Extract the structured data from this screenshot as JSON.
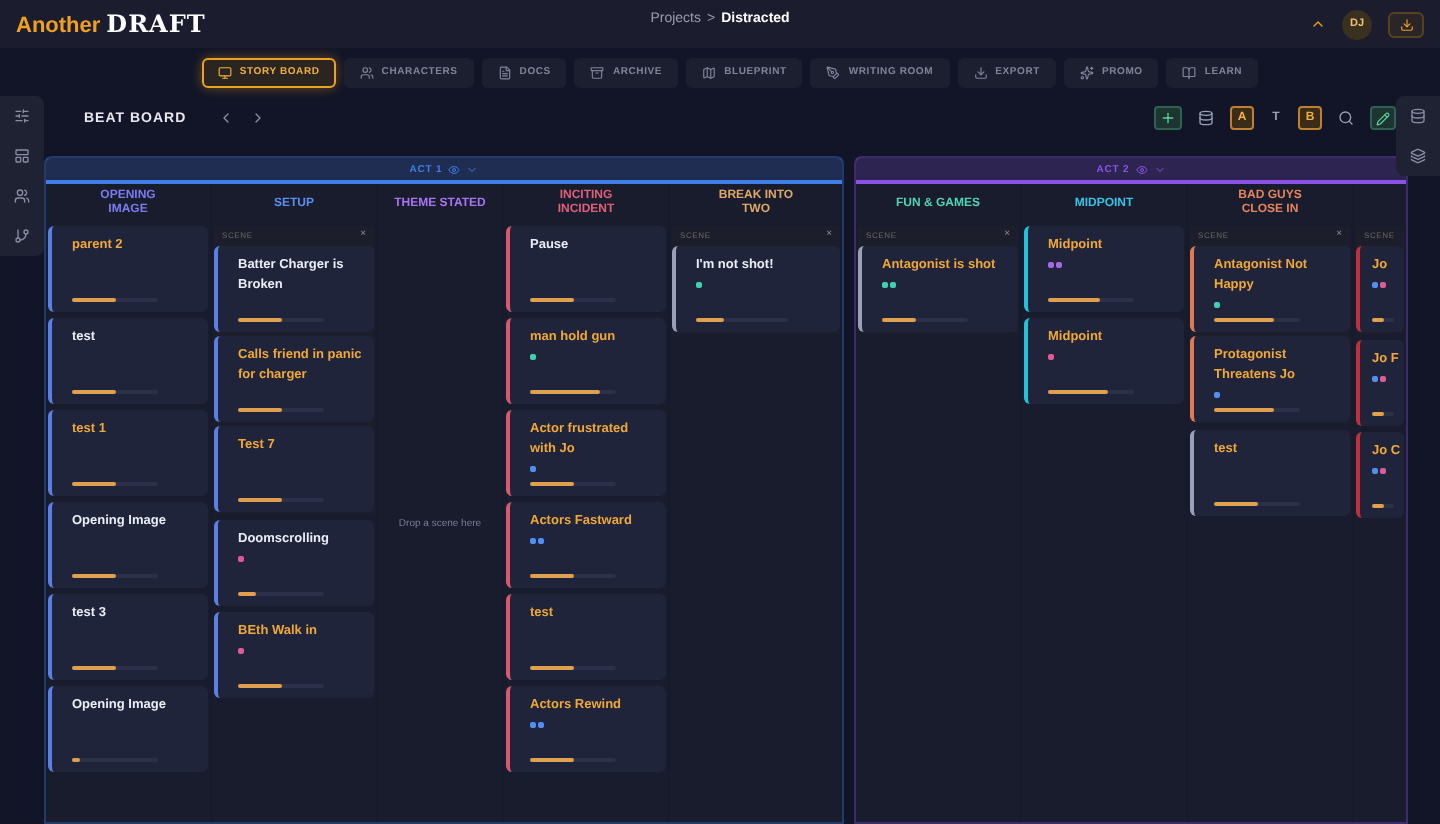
{
  "app": {
    "logo_first": "Another",
    "logo_second": "DRAFT"
  },
  "breadcrumb": {
    "parent": "Projects",
    "separator": ">",
    "current": "Distracted"
  },
  "user": {
    "initials": "DJ"
  },
  "tabs": [
    {
      "label": "STORY BOARD",
      "selected": true
    },
    {
      "label": "CHARACTERS",
      "selected": false
    },
    {
      "label": "DOCS",
      "selected": false
    },
    {
      "label": "ARCHIVE",
      "selected": false
    },
    {
      "label": "BLUEPRINT",
      "selected": false
    },
    {
      "label": "WRITING ROOM",
      "selected": false
    },
    {
      "label": "EXPORT",
      "selected": false
    },
    {
      "label": "PROMO",
      "selected": false
    },
    {
      "label": "LEARN",
      "selected": false
    }
  ],
  "toolbar": {
    "title": "BEAT BOARD",
    "tools": [
      {
        "kind": "add"
      },
      {
        "kind": "table"
      },
      {
        "kind": "letter",
        "label": "A",
        "active": true
      },
      {
        "kind": "letter",
        "label": "T",
        "active": false
      },
      {
        "kind": "letter",
        "label": "B",
        "active": true
      },
      {
        "kind": "search"
      },
      {
        "kind": "edit"
      }
    ]
  },
  "acts": [
    {
      "label": "ACT 1",
      "color": "#3f7fe6",
      "columns": [
        {
          "title": "OPENING IMAGE",
          "color": "#7b7bf2",
          "items": [
            {
              "kind": "card",
              "title": "parent 2",
              "highlighted": true,
              "color": "#5b7fe6",
              "level": 0.5
            },
            {
              "kind": "card",
              "title": "test",
              "highlighted": false,
              "color": "#5b7fe6",
              "level": 0.5
            },
            {
              "kind": "card",
              "title": "test 1",
              "highlighted": true,
              "color": "#5b7fe6",
              "level": 0.5
            },
            {
              "kind": "card",
              "title": "Opening Image",
              "highlighted": false,
              "color": "#5b7fe6",
              "level": 0.5
            },
            {
              "kind": "card",
              "title": "test 3",
              "highlighted": false,
              "color": "#5b7fe6",
              "level": 0.5
            },
            {
              "kind": "card",
              "title": "Opening Image",
              "highlighted": false,
              "color": "#5b7fe6",
              "level": 0.1
            }
          ]
        },
        {
          "title": "SETUP",
          "color": "#5b8ff0",
          "items": [
            {
              "kind": "group",
              "label": "SCENE",
              "close": "×",
              "cards": [
                {
                  "title": "Batter Charger is Broken",
                  "highlighted": false,
                  "color": "#5b7fe6",
                  "level": 0.5
                },
                {
                  "title": "Calls friend in panic for charger",
                  "highlighted": true,
                  "color": "#5b7fe6",
                  "level": 0.5
                },
                {
                  "title": "Test 7",
                  "highlighted": true,
                  "color": "#5b7fe6",
                  "level": 0.5
                }
              ]
            },
            {
              "kind": "card",
              "title": "Doomscrolling",
              "highlighted": false,
              "color": "#5b7fe6",
              "level": 0.2,
              "tags": [
                {
                  "color": "#e05a9a"
                }
              ]
            },
            {
              "kind": "card",
              "title": "BEth Walk in",
              "highlighted": true,
              "color": "#5b7fe6",
              "level": 0.5,
              "tags": [
                {
                  "color": "#e05a9a"
                }
              ]
            }
          ]
        },
        {
          "title": "THEME STATED",
          "color": "#a874f2",
          "hint": "Drop a scene here"
        },
        {
          "title": "INCITING INCIDENT",
          "color": "#e0607a",
          "items": [
            {
              "kind": "card",
              "title": "Pause",
              "highlighted": false,
              "color": "#d85a6e",
              "level": 0.5
            },
            {
              "kind": "card",
              "title": "man hold gun",
              "highlighted": true,
              "color": "#d85a6e",
              "level": 0.8,
              "tags": [
                {
                  "color": "#3fd0b0"
                }
              ]
            },
            {
              "kind": "card",
              "title": "Actor frustrated with Jo",
              "highlighted": true,
              "color": "#d85a6e",
              "level": 0.5,
              "tags": [
                {
                  "color": "#4f8ff0"
                }
              ]
            },
            {
              "kind": "card",
              "title": "Actors Fastward",
              "highlighted": true,
              "color": "#d85a6e",
              "level": 0.5,
              "tags": [
                {
                  "color": "#4f8ff0"
                },
                {
                  "color": "#4f8ff0"
                }
              ]
            },
            {
              "kind": "card",
              "title": "test",
              "highlighted": true,
              "color": "#d85a6e",
              "level": 0.5
            },
            {
              "kind": "card",
              "title": "Actors Rewind",
              "highlighted": true,
              "color": "#d85a6e",
              "level": 0.5,
              "tags": [
                {
                  "color": "#4f8ff0"
                },
                {
                  "color": "#4f8ff0"
                }
              ]
            }
          ]
        },
        {
          "title": "BREAK INTO TWO",
          "color": "#e0a868",
          "items": [
            {
              "kind": "group",
              "label": "SCENE",
              "close": "×",
              "cards": [
                {
                  "title": "I'm not shot!",
                  "highlighted": false,
                  "color": "#9aa0b8",
                  "level": 0.3,
                  "tags": [
                    {
                      "color": "#3fd0b0"
                    }
                  ]
                }
              ]
            }
          ]
        }
      ]
    },
    {
      "label": "ACT 2",
      "color": "#8c52e6",
      "columns": [
        {
          "title": "FUN & GAMES",
          "color": "#4fd4b4",
          "items": [
            {
              "kind": "group",
              "label": "SCENE",
              "close": "×",
              "cards": [
                {
                  "title": "Antagonist is shot",
                  "highlighted": true,
                  "color": "#9aa0b8",
                  "level": 0.4,
                  "tags": [
                    {
                      "color": "#3fd0b0"
                    },
                    {
                      "color": "#3fd0b0"
                    }
                  ]
                }
              ]
            }
          ]
        },
        {
          "title": "MIDPOINT",
          "color": "#38c4e6",
          "items": [
            {
              "kind": "card",
              "title": "Midpoint",
              "highlighted": true,
              "color": "#22c2dc",
              "level": 0.6,
              "tags": [
                {
                  "color": "#a06ae0"
                },
                {
                  "color": "#a06ae0"
                }
              ]
            },
            {
              "kind": "card",
              "title": "Midpoint",
              "highlighted": true,
              "color": "#22c2dc",
              "level": 0.7,
              "tags": [
                {
                  "color": "#e05a9a"
                }
              ]
            }
          ]
        },
        {
          "title": "BAD GUYS CLOSE IN",
          "color": "#e8845c",
          "items": [
            {
              "kind": "group",
              "label": "SCENE",
              "close": "×",
              "cards": [
                {
                  "title": "Antagonist Not Happy",
                  "highlighted": true,
                  "color": "#e07a52",
                  "level": 0.7,
                  "tags": [
                    {
                      "color": "#3fd0b0"
                    }
                  ]
                },
                {
                  "title": "Protagonist Threatens Jo",
                  "highlighted": true,
                  "color": "#e07a52",
                  "level": 0.7,
                  "tags": [
                    {
                      "color": "#4f8ff0"
                    }
                  ]
                }
              ]
            },
            {
              "kind": "card",
              "title": "test",
              "highlighted": true,
              "color": "#9aa0b8",
              "level": 0.5
            }
          ]
        },
        {
          "items": [
            {
              "kind": "group",
              "label": "SCENE",
              "cards": [
                {
                  "title": "Jo",
                  "highlighted": true,
                  "color": "#c0303a",
                  "level": 0.5,
                  "tags": [
                    {
                      "color": "#4f8ff0"
                    },
                    {
                      "color": "#e05a9a"
                    }
                  ]
                }
              ]
            },
            {
              "kind": "card",
              "title": "Jo F",
              "highlighted": true,
              "color": "#c0303a",
              "level": 0.5,
              "tags": [
                {
                  "color": "#4f8ff0"
                },
                {
                  "color": "#e05a9a"
                }
              ]
            },
            {
              "kind": "card",
              "title": "Jo C",
              "highlighted": true,
              "color": "#c0303a",
              "level": 0.5,
              "tags": [
                {
                  "color": "#4f8ff0"
                },
                {
                  "color": "#e05a9a"
                }
              ]
            }
          ]
        }
      ]
    }
  ]
}
